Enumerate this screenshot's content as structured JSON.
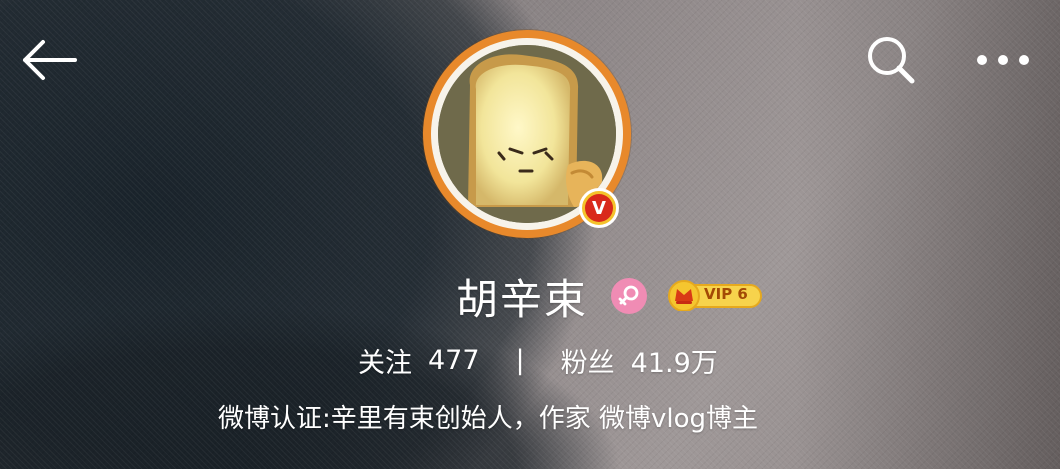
{
  "profile": {
    "name": "胡辛束",
    "vip_label": "VIP 6",
    "verified_badge": "V",
    "stats": {
      "following_label": "关注",
      "following_count": "477",
      "separator": "|",
      "followers_label": "粉丝",
      "followers_count": "41.9万"
    },
    "bio": "微博认证:辛里有束创始人，作家 微博vlog博主"
  },
  "icons": {
    "back": "arrow-left-icon",
    "search": "search-icon",
    "more": "more-dots-icon",
    "gender": "female-icon",
    "vip": "crown-icon",
    "verified": "verified-v-icon"
  },
  "colors": {
    "avatar_ring": "#e8892b",
    "verified_badge": "#d9291b",
    "gender_badge": "#f08cb4",
    "vip_badge": "#f4c22c"
  }
}
